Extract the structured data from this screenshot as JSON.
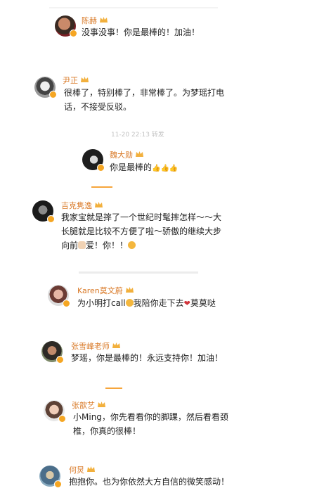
{
  "comments": [
    {
      "name": "陈赫",
      "text": "没事没事！你是最棒的！加油！"
    },
    {
      "name": "尹正",
      "text_line1": "很棒了，特别棒了，非常棒了。为梦瑶打电",
      "text_line2": "话，不接受反驳。"
    },
    {
      "timestamp_fragment": "11-20 22:13 转发"
    },
    {
      "name": "魏大勋",
      "text": "你是最棒的",
      "emojis": "👍👍👍"
    },
    {
      "name": "吉克隽逸",
      "text_line1": "我家宝就是摔了一个世纪时髦摔怎样～～大",
      "text_line2": "长腿就是比较不方便了啦～骄傲的继续大步",
      "text_line3_a": "向前",
      "text_line3_b": "爱！你！！",
      "emoji_end": "😘"
    },
    {
      "name": "Karen莫文蔚",
      "text_a": "为小明打call",
      "text_b": "我陪你走下去",
      "text_c": "莫莫哒"
    },
    {
      "name": "张雪峰老师",
      "text": "梦瑶，你是最棒的！永远支持你！加油！"
    },
    {
      "name": "张歆艺",
      "text_line1": "小Ming，你先看看你的脚踝，然后看看颈",
      "text_line2": "椎，你真的很棒！"
    },
    {
      "name": "何炅",
      "text": "抱抱你。也为你依然大方自信的微笑感动！"
    }
  ],
  "colors": {
    "name": "#d97a28",
    "badge": "#f5a623",
    "text": "#222222",
    "heart": "#d0343a"
  },
  "icons": [
    "avatar",
    "verified-badge-icon",
    "crown-icon",
    "thumbs-up-icon",
    "heart-icon",
    "kiss-emoji-icon"
  ]
}
